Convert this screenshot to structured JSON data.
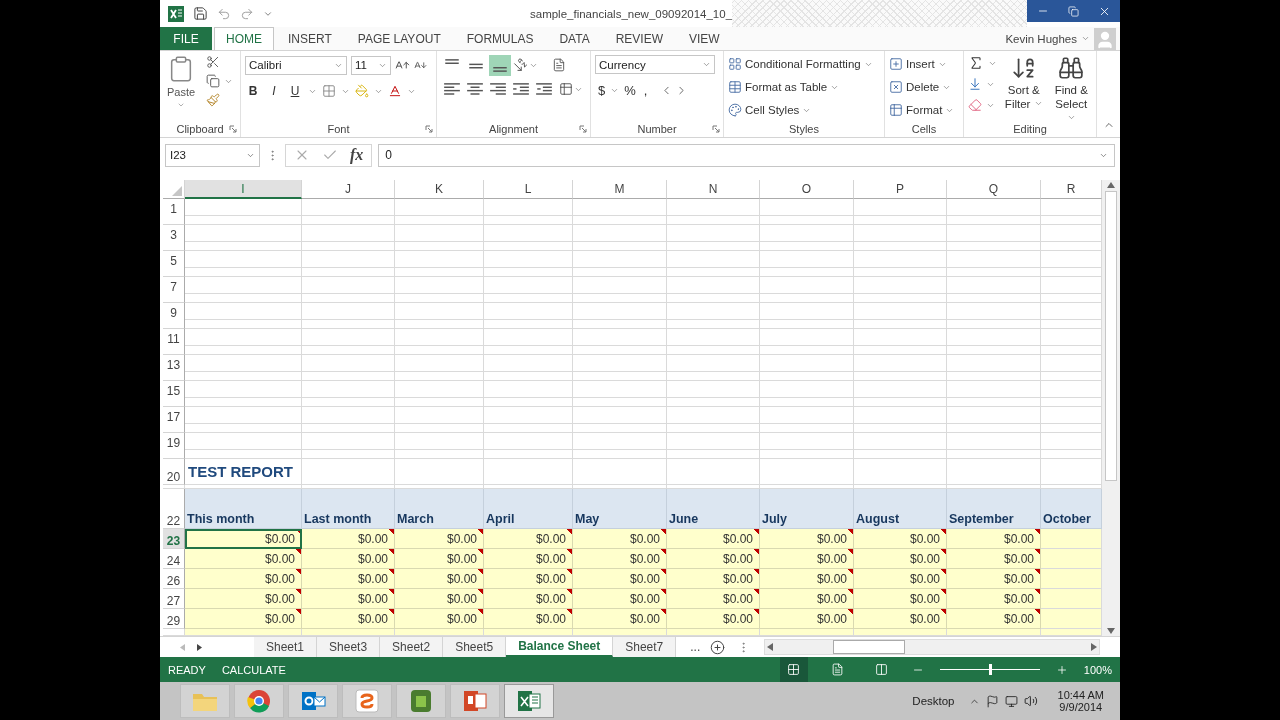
{
  "title_bar": {
    "document_title": "sample_financials_new_09092014_10_"
  },
  "ribbon_tabs": [
    {
      "label": "FILE",
      "kind": "file",
      "selected": false
    },
    {
      "label": "HOME",
      "kind": "tab",
      "selected": true
    },
    {
      "label": "INSERT",
      "kind": "tab",
      "selected": false
    },
    {
      "label": "PAGE LAYOUT",
      "kind": "tab",
      "selected": false
    },
    {
      "label": "FORMULAS",
      "kind": "tab",
      "selected": false
    },
    {
      "label": "DATA",
      "kind": "tab",
      "selected": false
    },
    {
      "label": "REVIEW",
      "kind": "tab",
      "selected": false
    },
    {
      "label": "VIEW",
      "kind": "tab",
      "selected": false
    }
  ],
  "user": {
    "name": "Kevin Hughes"
  },
  "ribbon": {
    "clipboard": {
      "label": "Clipboard",
      "paste": "Paste"
    },
    "font": {
      "label": "Font",
      "font_name": "Calibri",
      "font_size": "11",
      "style_buttons": [
        "B",
        "I",
        "U"
      ]
    },
    "alignment": {
      "label": "Alignment",
      "vertical": [
        {
          "selected": false
        },
        {
          "selected": false
        },
        {
          "selected": true
        }
      ]
    },
    "number": {
      "label": "Number",
      "format": "Currency",
      "symbols": [
        "$",
        "%",
        ","
      ]
    },
    "styles": {
      "label": "Styles",
      "commands": [
        "Conditional Formatting",
        "Format as Table",
        "Cell Styles"
      ]
    },
    "cells": {
      "label": "Cells",
      "commands": [
        "Insert",
        "Delete",
        "Format"
      ]
    },
    "editing": {
      "label": "Editing",
      "commands": [
        "Sort & Filter",
        "Find & Select"
      ]
    }
  },
  "formula_bar": {
    "name_box": "I23",
    "function_button": "fx",
    "value": "0"
  },
  "columns": [
    {
      "label": "I",
      "selected": true
    },
    {
      "label": "J",
      "selected": false
    },
    {
      "label": "K",
      "selected": false
    },
    {
      "label": "L",
      "selected": false
    },
    {
      "label": "M",
      "selected": false
    },
    {
      "label": "N",
      "selected": false
    },
    {
      "label": "O",
      "selected": false
    },
    {
      "label": "P",
      "selected": false
    },
    {
      "label": "Q",
      "selected": false
    },
    {
      "label": "R",
      "selected": false
    }
  ],
  "rows": [
    {
      "header": "1",
      "kind": "blank",
      "selected": false
    },
    {
      "header": "3",
      "kind": "blank",
      "selected": false
    },
    {
      "header": "5",
      "kind": "blank",
      "selected": false
    },
    {
      "header": "7",
      "kind": "blank",
      "selected": false
    },
    {
      "header": "9",
      "kind": "blank",
      "selected": false
    },
    {
      "header": "11",
      "kind": "blank",
      "selected": false
    },
    {
      "header": "13",
      "kind": "blank",
      "selected": false
    },
    {
      "header": "15",
      "kind": "blank",
      "selected": false
    },
    {
      "header": "17",
      "kind": "blank",
      "selected": false
    },
    {
      "header": "19",
      "kind": "blank",
      "selected": false
    },
    {
      "header": "20",
      "kind": "title",
      "selected": false,
      "text": "TEST REPORT"
    },
    {
      "header": "22",
      "kind": "heading",
      "selected": false,
      "cells": [
        "This month",
        "Last month",
        "March",
        "April",
        "May",
        "June",
        "July",
        "August",
        "September",
        "October"
      ]
    },
    {
      "header": "23",
      "kind": "values",
      "selected": true,
      "comments": true,
      "cells": [
        "$0.00",
        "$0.00",
        "$0.00",
        "$0.00",
        "$0.00",
        "$0.00",
        "$0.00",
        "$0.00",
        "$0.00"
      ]
    },
    {
      "header": "24",
      "kind": "values",
      "selected": false,
      "comments": true,
      "cells": [
        "$0.00",
        "$0.00",
        "$0.00",
        "$0.00",
        "$0.00",
        "$0.00",
        "$0.00",
        "$0.00",
        "$0.00"
      ]
    },
    {
      "header": "26",
      "kind": "values",
      "selected": false,
      "comments": true,
      "cells": [
        "$0.00",
        "$0.00",
        "$0.00",
        "$0.00",
        "$0.00",
        "$0.00",
        "$0.00",
        "$0.00",
        "$0.00"
      ]
    },
    {
      "header": "27",
      "kind": "values",
      "selected": false,
      "comments": true,
      "cells": [
        "$0.00",
        "$0.00",
        "$0.00",
        "$0.00",
        "$0.00",
        "$0.00",
        "$0.00",
        "$0.00",
        "$0.00"
      ]
    },
    {
      "header": "29",
      "kind": "values",
      "selected": false,
      "comments": true,
      "cells": [
        "$0.00",
        "$0.00",
        "$0.00",
        "$0.00",
        "$0.00",
        "$0.00",
        "$0.00",
        "$0.00",
        "$0.00"
      ]
    }
  ],
  "sheet_tabs": [
    {
      "label": "Sheet1",
      "selected": false
    },
    {
      "label": "Sheet3",
      "selected": false
    },
    {
      "label": "Sheet2",
      "selected": false
    },
    {
      "label": "Sheet5",
      "selected": false
    },
    {
      "label": "Balance Sheet",
      "selected": true
    },
    {
      "label": "Sheet7",
      "selected": false
    }
  ],
  "sheet_tabs_more": "...",
  "status_bar": {
    "messages": [
      "READY",
      "CALCULATE"
    ],
    "views": [
      {
        "selected": true
      },
      {
        "selected": false
      },
      {
        "selected": false
      }
    ],
    "zoom_slider": {
      "level": 0.5
    },
    "zoom": "100%"
  },
  "taskbar": {
    "apps": [
      {
        "kind": "folder",
        "selected": false
      },
      {
        "kind": "chrome",
        "selected": false
      },
      {
        "kind": "outlook",
        "selected": false
      },
      {
        "kind": "swirl",
        "selected": false
      },
      {
        "kind": "evernote",
        "selected": false
      },
      {
        "kind": "powerpoint",
        "selected": false
      },
      {
        "kind": "excel",
        "selected": true
      }
    ],
    "desktop_label": "Desktop",
    "time": "10:44 AM",
    "date": "9/9/2014"
  }
}
